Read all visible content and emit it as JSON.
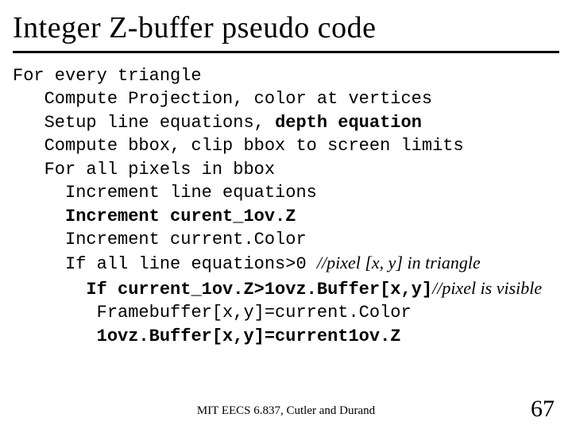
{
  "title": "Integer Z-buffer pseudo code",
  "code": {
    "l1": "For every triangle",
    "l2": "Compute Projection, color at vertices",
    "l3a": "Setup line equations, ",
    "l3b": "depth equation",
    "l4": "Compute bbox, clip bbox to screen limits",
    "l5": "For all pixels in bbox",
    "l6": "Increment line equations",
    "l7": "Increment curent_1ov.Z",
    "l8": "Increment current.Color",
    "l9a": "If all line equations>0 ",
    "l9c": "//pixel [x, y] in triangle",
    "l10a": "If current_1ov.Z>1ovz.Buffer[x,y]",
    "l10c": "//pixel is visible",
    "l11": "Framebuffer[x,y]=current.Color",
    "l12": "1ovz.Buffer[x,y]=current1ov.Z"
  },
  "footer": {
    "center": "MIT EECS 6.837, Cutler and Durand",
    "page": "67"
  }
}
